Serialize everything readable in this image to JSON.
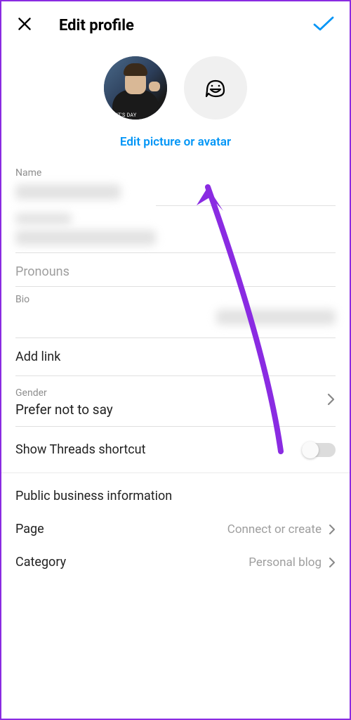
{
  "header": {
    "title": "Edit profile"
  },
  "picture": {
    "edit_label": "Edit picture or avatar"
  },
  "fields": {
    "name_label": "Name",
    "pronouns_placeholder": "Pronouns",
    "bio_label": "Bio",
    "add_link": "Add link",
    "gender_label": "Gender",
    "gender_value": "Prefer not to say",
    "threads_label": "Show Threads shortcut"
  },
  "business": {
    "section_title": "Public business information",
    "page_label": "Page",
    "page_value": "Connect or create",
    "category_label": "Category",
    "category_value": "Personal blog"
  }
}
